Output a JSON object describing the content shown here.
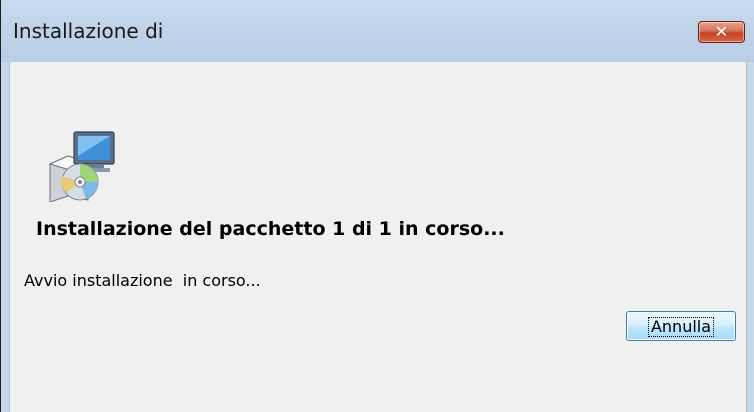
{
  "window": {
    "title": "Installazione di",
    "close_label": "✕"
  },
  "content": {
    "icon": "installer-package-icon",
    "heading": "Installazione del pacchetto 1 di 1 in corso...",
    "status": "Avvio installazione  in corso...",
    "cancel_label": "Annulla"
  },
  "colors": {
    "titlebar": "#c6d7ea",
    "client_background": "#f0f0f0",
    "close_button": "#c24323",
    "button_border": "#3c7fb1"
  }
}
